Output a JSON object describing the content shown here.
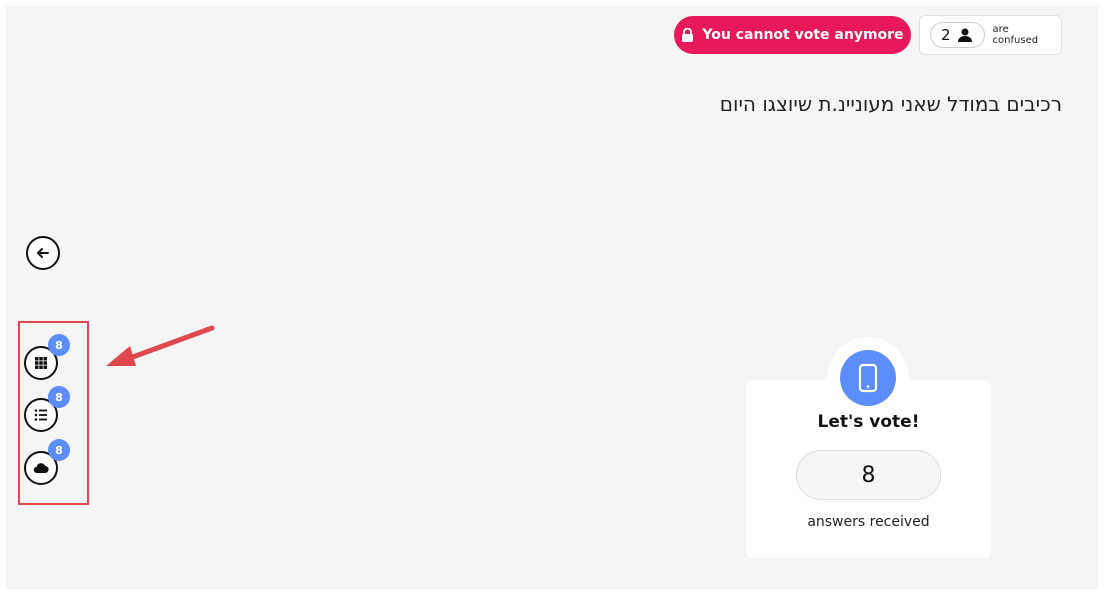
{
  "status": {
    "vote_locked_label": "You cannot vote anymore",
    "vote_locked_color": "#e8195a",
    "confused_count": "2",
    "confused_label_line1": "are",
    "confused_label_line2": "confused"
  },
  "question": {
    "text": "רכיבים במודל שאני מעוניינ.ת שיוצגו היום"
  },
  "nav": {
    "back_icon": "arrow-left-icon"
  },
  "tools": [
    {
      "name": "grid-view",
      "icon": "grid-icon",
      "badge": "8"
    },
    {
      "name": "list-view",
      "icon": "list-icon",
      "badge": "8"
    },
    {
      "name": "word-cloud-view",
      "icon": "cloud-icon",
      "badge": "8"
    }
  ],
  "vote_card": {
    "icon": "smartphone-icon",
    "title": "Let's vote!",
    "answers_count": "8",
    "answers_label": "answers received",
    "accent_color": "#5b8dfb"
  },
  "annotation": {
    "highlight_color": "#e0484f"
  }
}
